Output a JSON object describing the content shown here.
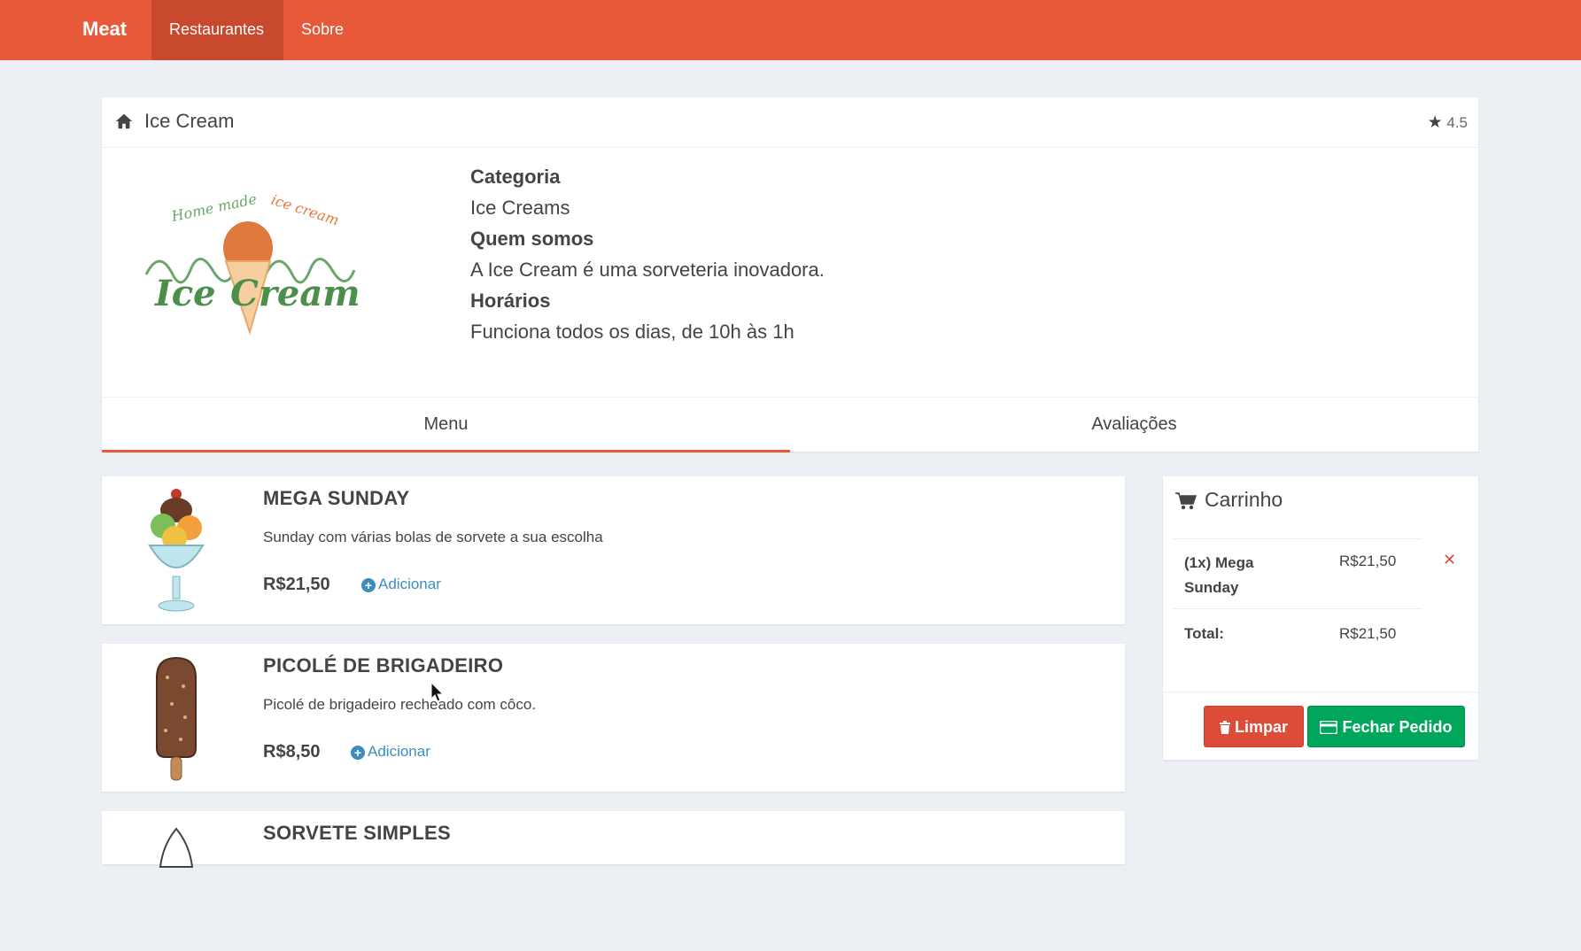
{
  "navbar": {
    "brand": "Meat",
    "items": [
      {
        "label": "Restaurantes",
        "active": true
      },
      {
        "label": "Sobre",
        "active": false
      }
    ],
    "color": "#e8593a"
  },
  "restaurant": {
    "name": "Ice Cream",
    "rating": "4.5",
    "logo_alt": "Home made ice cream",
    "category_label": "Categoria",
    "category": "Ice Creams",
    "about_label": "Quem somos",
    "about": "A Ice Cream é uma sorveteria inovadora.",
    "hours_label": "Horários",
    "hours": "Funciona todos os dias, de 10h às 1h"
  },
  "tabs": [
    {
      "label": "Menu",
      "active": true
    },
    {
      "label": "Avaliações",
      "active": false
    }
  ],
  "menu": [
    {
      "name": "MEGA SUNDAY",
      "description": "Sunday com várias bolas de sorvete a sua escolha",
      "price": "R$21,50",
      "add_label": "Adicionar",
      "icon": "sundae-image"
    },
    {
      "name": "PICOLÉ DE BRIGADEIRO",
      "description": "Picolé de brigadeiro recheado com côco.",
      "price": "R$8,50",
      "add_label": "Adicionar",
      "icon": "popsicle-image"
    },
    {
      "name": "SORVETE SIMPLES",
      "icon": "ice-cream-cone-image"
    }
  ],
  "cart": {
    "title": "Carrinho",
    "items": [
      {
        "name": "(1x) Mega Sunday",
        "price": "R$21,50"
      }
    ],
    "total_label": "Total:",
    "total": "R$21,50",
    "clear_label": "Limpar",
    "checkout_label": "Fechar Pedido"
  },
  "colors": {
    "accent": "#e8593a",
    "link": "#3c8dbc",
    "danger": "#dd4b39",
    "success": "#00a65a",
    "background": "#ecf0f5"
  }
}
